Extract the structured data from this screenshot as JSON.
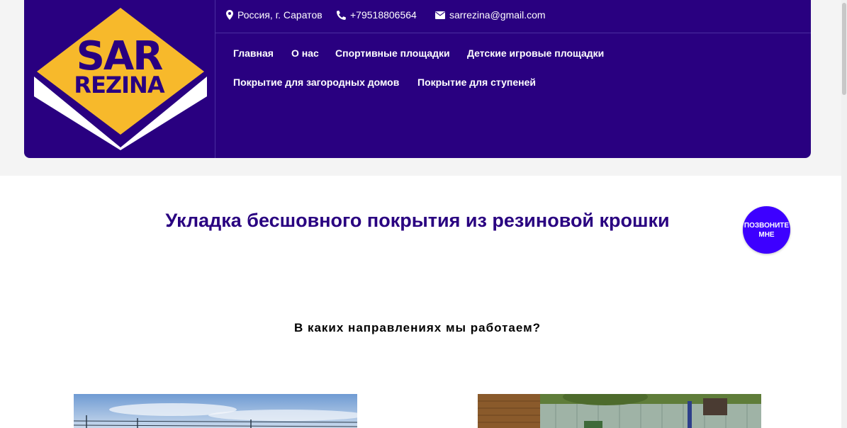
{
  "header": {
    "logo": {
      "line1": "SAR",
      "line2": "REZINA"
    },
    "contacts": {
      "location": "Россия, г. Саратов",
      "phone": "+79518806564",
      "email": "sarrezina@gmail.com"
    },
    "nav": [
      {
        "label": "Главная"
      },
      {
        "label": "О нас"
      },
      {
        "label": "Спортивные площадки"
      },
      {
        "label": "Детские игровые площадки"
      },
      {
        "label": "Покрытие для загородных домов"
      },
      {
        "label": "Покрытие для ступеней"
      }
    ]
  },
  "main": {
    "title": "Укладка бесшовного покрытия из резиновой крошки",
    "call_button": {
      "line1": "ПОЗВОНИТЕ",
      "line2": "МНЕ"
    },
    "subheading": "В каких направлениях мы работаем?"
  },
  "colors": {
    "brand_purple": "#290080",
    "logo_yellow": "#f7b92b",
    "call_button": "#3d00ff"
  },
  "icons": {
    "location": "map-marker-icon",
    "phone": "phone-icon",
    "email": "envelope-icon"
  }
}
